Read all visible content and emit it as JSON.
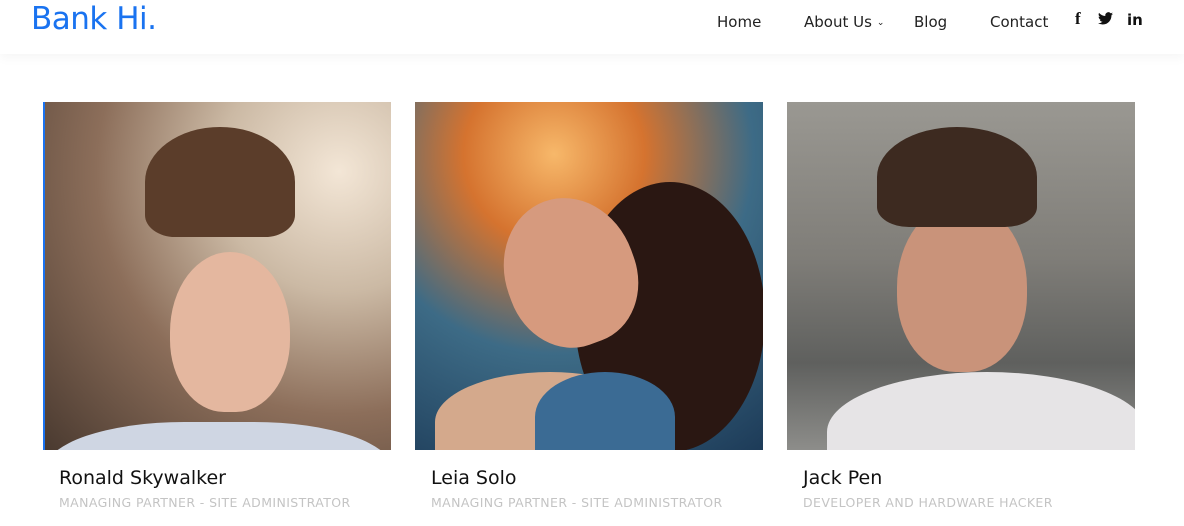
{
  "header": {
    "logo": "Bank Hi.",
    "nav": [
      {
        "label": "Home"
      },
      {
        "label": "About Us",
        "has_dropdown": true
      },
      {
        "label": "Blog"
      },
      {
        "label": "Contact"
      }
    ],
    "social": [
      {
        "icon": "facebook-icon",
        "glyph": "f"
      },
      {
        "icon": "twitter-icon",
        "glyph": "🐦"
      },
      {
        "icon": "linkedin-icon",
        "glyph": "in"
      }
    ]
  },
  "team": [
    {
      "name": "Ronald Skywalker",
      "role": "MANAGING PARTNER - SITE ADMINISTRATOR"
    },
    {
      "name": "Leia Solo",
      "role": "MANAGING PARTNER - SITE ADMINISTRATOR"
    },
    {
      "name": "Jack Pen",
      "role": "DEVELOPER AND HARDWARE HACKER"
    }
  ],
  "colors": {
    "brand": "#1a73f0"
  }
}
